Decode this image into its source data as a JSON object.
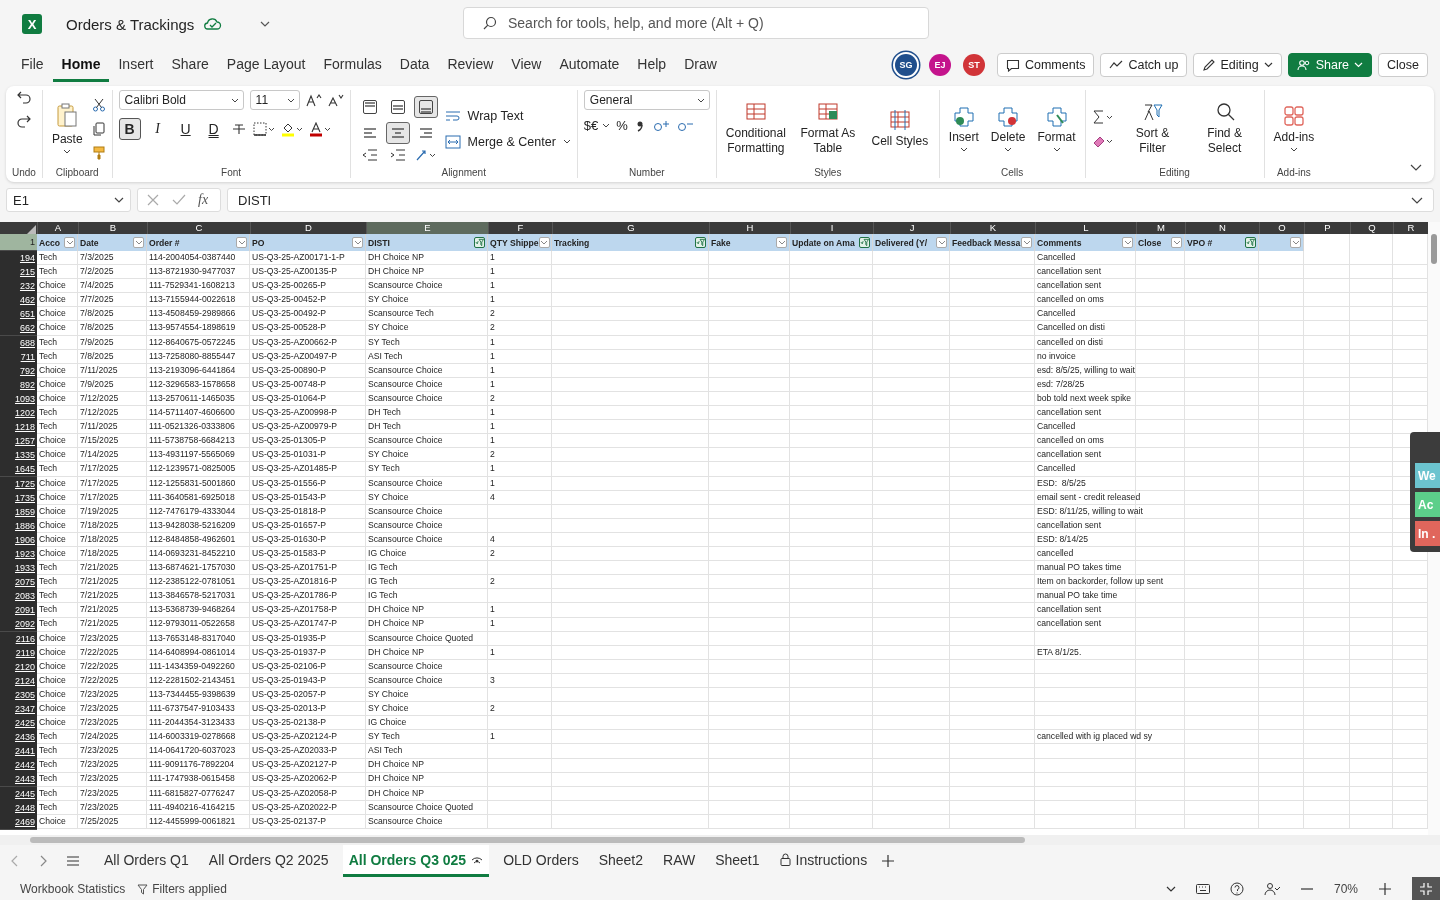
{
  "title_bar": {
    "app_letter": "X",
    "file_name": "Orders & Trackings",
    "search": {
      "placeholder": "Search for tools, help, and more (Alt + Q)"
    }
  },
  "menu": [
    {
      "label": "File",
      "selected": false
    },
    {
      "label": "Home",
      "selected": true
    },
    {
      "label": "Insert",
      "selected": false
    },
    {
      "label": "Share",
      "selected": false
    },
    {
      "label": "Page Layout",
      "selected": false
    },
    {
      "label": "Formulas",
      "selected": false
    },
    {
      "label": "Data",
      "selected": false
    },
    {
      "label": "Review",
      "selected": false
    },
    {
      "label": "View",
      "selected": false
    },
    {
      "label": "Automate",
      "selected": false
    },
    {
      "label": "Help",
      "selected": false
    },
    {
      "label": "Draw",
      "selected": false
    }
  ],
  "avatars": [
    {
      "initials": "SG",
      "color": "#1f4e8c"
    },
    {
      "initials": "EJ",
      "color": "#c4148c"
    },
    {
      "initials": "ST",
      "color": "#d13438"
    }
  ],
  "actions": [
    {
      "label": "Comments",
      "kind": "comments"
    },
    {
      "label": "Catch up",
      "kind": "catchup"
    },
    {
      "label": "Editing",
      "kind": "editing"
    },
    {
      "label": "Share",
      "kind": "share"
    },
    {
      "label": "Close",
      "kind": "close"
    }
  ],
  "ribbon": {
    "undo_label": "Undo",
    "paste": "Paste",
    "clipboard_label": "Clipboard",
    "font_name": "Calibri Bold",
    "font_size": "11",
    "format_buttons": [
      {
        "label": "B",
        "kind": "bold",
        "selected": true
      },
      {
        "label": "I",
        "kind": "italic",
        "selected": false
      },
      {
        "label": "U",
        "kind": "underline",
        "selected": false
      },
      {
        "label": "D",
        "kind": "double",
        "selected": false
      }
    ],
    "font_label": "Font",
    "align_buttons": [
      {
        "kind": "top",
        "selected": false
      },
      {
        "kind": "middle",
        "selected": false
      },
      {
        "kind": "bottom",
        "selected": true
      },
      {
        "kind": "left",
        "selected": false
      },
      {
        "kind": "center",
        "selected": true
      },
      {
        "kind": "right",
        "selected": false
      }
    ],
    "wrap_text": "Wrap Text",
    "merge": "Merge & Center",
    "alignment_label": "Alignment",
    "number_format": "General",
    "currency": "$€",
    "percent": "%",
    "number_label": "Number",
    "styles": [
      "Conditional Formatting",
      "Format As Table",
      "Cell Styles"
    ],
    "styles_label": "Styles",
    "cells": [
      "Insert",
      "Delete",
      "Format"
    ],
    "cells_label": "Cells",
    "editing": [
      "Sort & Filter",
      "Find & Select"
    ],
    "editing_label": "Editing",
    "addins": "Add-ins",
    "addins_label": "Add-ins"
  },
  "formula_bar": {
    "name_box": "E1",
    "fx": "fx",
    "value": "DISTI"
  },
  "header_row_number": "1",
  "columns": [
    {
      "letter": "A",
      "header": "Acco",
      "filter_button": true,
      "filtered": false,
      "selected": false
    },
    {
      "letter": "B",
      "header": "Date",
      "filter_button": true,
      "filtered": false,
      "selected": false
    },
    {
      "letter": "C",
      "header": "Order #",
      "filter_button": true,
      "filtered": false,
      "selected": false
    },
    {
      "letter": "D",
      "header": "PO",
      "filter_button": true,
      "filtered": false,
      "selected": false
    },
    {
      "letter": "E",
      "header": "DISTI",
      "filter_button": true,
      "filtered": true,
      "selected": true
    },
    {
      "letter": "F",
      "header": "QTY Shippe",
      "filter_button": true,
      "filtered": false,
      "selected": false
    },
    {
      "letter": "G",
      "header": "Tracking",
      "filter_button": true,
      "filtered": true,
      "selected": false
    },
    {
      "letter": "H",
      "header": "Fake",
      "filter_button": true,
      "filtered": false,
      "selected": false
    },
    {
      "letter": "I",
      "header": "Update on Ama",
      "filter_button": true,
      "filtered": true,
      "selected": false
    },
    {
      "letter": "J",
      "header": "Delivered (Y/",
      "filter_button": true,
      "filtered": false,
      "selected": false
    },
    {
      "letter": "K",
      "header": "Feedback Messa",
      "filter_button": true,
      "filtered": false,
      "selected": false
    },
    {
      "letter": "L",
      "header": "Comments",
      "filter_button": true,
      "filtered": false,
      "selected": false
    },
    {
      "letter": "M",
      "header": "Close",
      "filter_button": true,
      "filtered": false,
      "selected": false
    },
    {
      "letter": "N",
      "header": "VPO #",
      "filter_button": true,
      "filtered": true,
      "selected": false
    },
    {
      "letter": "O",
      "filter_button": true,
      "filtered": false,
      "selected": false
    },
    {
      "letter": "P",
      "filter_button": false,
      "filtered": false,
      "selected": false
    },
    {
      "letter": "Q",
      "filter_button": false,
      "filtered": false,
      "selected": false
    },
    {
      "letter": "R",
      "filter_button": false,
      "filtered": false,
      "selected": false
    }
  ],
  "rows": [
    {
      "row": "194",
      "account": "Tech",
      "date": "7/3/2025",
      "order": "114-2004054-0387440",
      "po": "US-Q3-25-AZ00171-1-P",
      "disti": "DH Choice NP",
      "qty": "1",
      "comment": "Cancelled"
    },
    {
      "row": "215",
      "account": "Tech",
      "date": "7/2/2025",
      "order": "113-8721930-9477037",
      "po": "US-Q3-25-AZ00135-P",
      "disti": "DH Choice NP",
      "qty": "1",
      "comment": "cancellation sent"
    },
    {
      "row": "232",
      "account": "Choice",
      "date": "7/4/2025",
      "order": "111-7529341-1608213",
      "po": "US-Q3-25-00265-P",
      "disti": "Scansource Choice",
      "qty": "1",
      "comment": "cancellation sent"
    },
    {
      "row": "462",
      "account": "Choice",
      "date": "7/7/2025",
      "order": "113-7155944-0022618",
      "po": "US-Q3-25-00452-P",
      "disti": "SY Choice",
      "qty": "1",
      "comment": "cancelled on oms"
    },
    {
      "row": "651",
      "account": "Choice",
      "date": "7/8/2025",
      "order": "113-4508459-2989866",
      "po": "US-Q3-25-00492-P",
      "disti": "Scansource Tech",
      "qty": "2",
      "comment": "Cancelled"
    },
    {
      "row": "662",
      "account": "Choice",
      "date": "7/8/2025",
      "order": "113-9574554-1898619",
      "po": "US-Q3-25-00528-P",
      "disti": "SY Choice",
      "qty": "2",
      "comment": "Cancelled on disti"
    },
    {
      "row": "688",
      "account": "Tech",
      "date": "7/9/2025",
      "order": "112-8640675-0572245",
      "po": "US-Q3-25-AZ00662-P",
      "disti": "SY Tech",
      "qty": "1",
      "comment": "cancelled on disti"
    },
    {
      "row": "711",
      "account": "Tech",
      "date": "7/8/2025",
      "order": "113-7258080-8855447",
      "po": "US-Q3-25-AZ00497-P",
      "disti": "ASI Tech",
      "qty": "1",
      "comment": "no invoice"
    },
    {
      "row": "792",
      "account": "Choice",
      "date": "7/11/2025",
      "order": "113-2193096-6441864",
      "po": "US-Q3-25-00890-P",
      "disti": "Scansource Choice",
      "qty": "1",
      "comment": "esd: 8/5/25, willing to wait"
    },
    {
      "row": "892",
      "account": "Choice",
      "date": "7/9/2025",
      "order": "112-3296583-1578658",
      "po": "US-Q3-25-00748-P",
      "disti": "Scansource Choice",
      "qty": "1",
      "comment": "esd: 7/28/25"
    },
    {
      "row": "1093",
      "account": "Choice",
      "date": "7/12/2025",
      "order": "113-2570611-1465035",
      "po": "US-Q3-25-01064-P",
      "disti": "Scansource Choice",
      "qty": "2",
      "comment": "bob told next week spike"
    },
    {
      "row": "1202",
      "account": "Tech",
      "date": "7/12/2025",
      "order": "114-5711407-4606600",
      "po": "US-Q3-25-AZ00998-P",
      "disti": "DH Tech",
      "qty": "1",
      "comment": "cancellation sent"
    },
    {
      "row": "1218",
      "account": "Tech",
      "date": "7/11/2025",
      "order": "111-0521326-0333806",
      "po": "US-Q3-25-AZ00979-P",
      "disti": "DH Tech",
      "qty": "1",
      "comment": "Cancelled"
    },
    {
      "row": "1257",
      "account": "Choice",
      "date": "7/15/2025",
      "order": "111-5738758-6684213",
      "po": "US-Q3-25-01305-P",
      "disti": "Scansource Choice",
      "qty": "1",
      "comment": "cancelled on oms"
    },
    {
      "row": "1335",
      "account": "Choice",
      "date": "7/14/2025",
      "order": "113-4931197-5565069",
      "po": "US-Q3-25-01031-P",
      "disti": "SY Choice",
      "qty": "2",
      "comment": "cancellation sent"
    },
    {
      "row": "1645",
      "account": "Tech",
      "date": "7/17/2025",
      "order": "112-1239571-0825005",
      "po": "US-Q3-25-AZ01485-P",
      "disti": "SY Tech",
      "qty": "1",
      "comment": "Cancelled"
    },
    {
      "row": "1725",
      "account": "Choice",
      "date": "7/17/2025",
      "order": "112-1255831-5001860",
      "po": "US-Q3-25-01556-P",
      "disti": "Scansource Choice",
      "qty": "1",
      "comment": "ESD:  8/5/25"
    },
    {
      "row": "1735",
      "account": "Choice",
      "date": "7/17/2025",
      "order": "111-3640581-6925018",
      "po": "US-Q3-25-01543-P",
      "disti": "SY Choice",
      "qty": "4",
      "comment": "email sent - credit released"
    },
    {
      "row": "1859",
      "account": "Choice",
      "date": "7/19/2025",
      "order": "112-7476179-4333044",
      "po": "US-Q3-25-01818-P",
      "disti": "Scansource Choice",
      "comment": "ESD: 8/11/25, willing to wait"
    },
    {
      "row": "1886",
      "account": "Choice",
      "date": "7/18/2025",
      "order": "113-9428038-5216209",
      "po": "US-Q3-25-01657-P",
      "disti": "Scansource Choice",
      "comment": "cancellation sent"
    },
    {
      "row": "1906",
      "account": "Choice",
      "date": "7/18/2025",
      "order": "112-8484858-4962601",
      "po": "US-Q3-25-01630-P",
      "disti": "Scansource Choice",
      "qty": "4",
      "comment": "ESD: 8/14/25"
    },
    {
      "row": "1923",
      "account": "Choice",
      "date": "7/18/2025",
      "order": "114-0693231-8452210",
      "po": "US-Q3-25-01583-P",
      "disti": "IG Choice",
      "qty": "2",
      "comment": "cancelled"
    },
    {
      "row": "1933",
      "account": "Tech",
      "date": "7/21/2025",
      "order": "113-6874621-1757030",
      "po": "US-Q3-25-AZ01751-P",
      "disti": "IG Tech",
      "comment": "manual PO takes time"
    },
    {
      "row": "2075",
      "account": "Tech",
      "date": "7/21/2025",
      "order": "112-2385122-0781051",
      "po": "US-Q3-25-AZ01816-P",
      "disti": "IG Tech",
      "qty": "2",
      "comment": "Item on backorder, follow up sent"
    },
    {
      "row": "2083",
      "account": "Tech",
      "date": "7/21/2025",
      "order": "113-3846578-5217031",
      "po": "US-Q3-25-AZ01786-P",
      "disti": "IG Tech",
      "comment": "manual PO take time"
    },
    {
      "row": "2091",
      "account": "Tech",
      "date": "7/21/2025",
      "order": "113-5368739-9468264",
      "po": "US-Q3-25-AZ01758-P",
      "disti": "DH Choice NP",
      "qty": "1",
      "comment": "cancellation sent"
    },
    {
      "row": "2092",
      "account": "Tech",
      "date": "7/21/2025",
      "order": "112-9793011-0522658",
      "po": "US-Q3-25-AZ01747-P",
      "disti": "DH Choice NP",
      "qty": "1",
      "comment": "cancellation sent"
    },
    {
      "row": "2116",
      "account": "Choice",
      "date": "7/23/2025",
      "order": "113-7653148-8317040",
      "po": "US-Q3-25-01935-P",
      "disti": "Scansource Choice Quoted"
    },
    {
      "row": "2119",
      "account": "Choice",
      "date": "7/22/2025",
      "order": "114-6408994-0861014",
      "po": "US-Q3-25-01937-P",
      "disti": "DH Choice NP",
      "qty": "1",
      "comment": "ETA 8/1/25."
    },
    {
      "row": "2120",
      "account": "Choice",
      "date": "7/22/2025",
      "order": "111-1434359-0492260",
      "po": "US-Q3-25-02106-P",
      "disti": "Scansource Choice"
    },
    {
      "row": "2124",
      "account": "Choice",
      "date": "7/22/2025",
      "order": "112-2281502-2143451",
      "po": "US-Q3-25-01943-P",
      "disti": "Scansource Choice",
      "qty": "3"
    },
    {
      "row": "2305",
      "account": "Choice",
      "date": "7/23/2025",
      "order": "113-7344455-9398639",
      "po": "US-Q3-25-02057-P",
      "disti": "SY Choice"
    },
    {
      "row": "2347",
      "account": "Choice",
      "date": "7/23/2025",
      "order": "111-6737547-9103433",
      "po": "US-Q3-25-02013-P",
      "disti": "SY Choice",
      "qty": "2"
    },
    {
      "row": "2425",
      "account": "Choice",
      "date": "7/23/2025",
      "order": "111-2044354-3123433",
      "po": "US-Q3-25-02138-P",
      "disti": "IG Choice"
    },
    {
      "row": "2436",
      "account": "Tech",
      "date": "7/24/2025",
      "order": "114-6003319-0278668",
      "po": "US-Q3-25-AZ02124-P",
      "disti": "SY Tech",
      "qty": "1",
      "comment": "cancelled with ig placed wd sy"
    },
    {
      "row": "2441",
      "account": "Tech",
      "date": "7/23/2025",
      "order": "114-0641720-6037023",
      "po": "US-Q3-25-AZ02033-P",
      "disti": "ASI Tech"
    },
    {
      "row": "2442",
      "account": "Tech",
      "date": "7/23/2025",
      "order": "111-9091176-7892204",
      "po": "US-Q3-25-AZ02127-P",
      "disti": "DH Choice NP"
    },
    {
      "row": "2443",
      "account": "Tech",
      "date": "7/23/2025",
      "order": "111-1747938-0615458",
      "po": "US-Q3-25-AZ02062-P",
      "disti": "DH Choice NP"
    },
    {
      "row": "2445",
      "account": "Tech",
      "date": "7/23/2025",
      "order": "111-6815827-0776247",
      "po": "US-Q3-25-AZ02058-P",
      "disti": "DH Choice NP"
    },
    {
      "row": "2448",
      "account": "Tech",
      "date": "7/23/2025",
      "order": "111-4940216-4164215",
      "po": "US-Q3-25-AZ02022-P",
      "disti": "Scansource Choice Quoted"
    },
    {
      "row": "2469",
      "account": "Choice",
      "date": "7/25/2025",
      "order": "112-4455999-0061821",
      "po": "US-Q3-25-02137-P",
      "disti": "Scansource Choice"
    }
  ],
  "side_panel": [
    {
      "label": "We",
      "color": "#6cc4cf"
    },
    {
      "label": "Ac",
      "color": "#5ccf8a"
    },
    {
      "label": "In .",
      "color": "#e0665c"
    }
  ],
  "sheet_tabs": [
    {
      "label": "All Orders Q1",
      "selected": false,
      "locked": false,
      "shared": false
    },
    {
      "label": "All Orders Q2 2025",
      "selected": false,
      "locked": false,
      "shared": false
    },
    {
      "label": "All Orders Q3 025",
      "selected": true,
      "locked": false,
      "shared": true
    },
    {
      "label": "OLD Orders",
      "selected": false,
      "locked": false,
      "shared": false
    },
    {
      "label": "Sheet2",
      "selected": false,
      "locked": false,
      "shared": false
    },
    {
      "label": "RAW",
      "selected": false,
      "locked": false,
      "shared": false
    },
    {
      "label": "Sheet1",
      "selected": false,
      "locked": false,
      "shared": false
    },
    {
      "label": "Instructions",
      "selected": false,
      "locked": true,
      "shared": false
    }
  ],
  "status_bar": {
    "statistics": "Workbook Statistics",
    "filters": "Filters applied",
    "zoom": "70%"
  }
}
